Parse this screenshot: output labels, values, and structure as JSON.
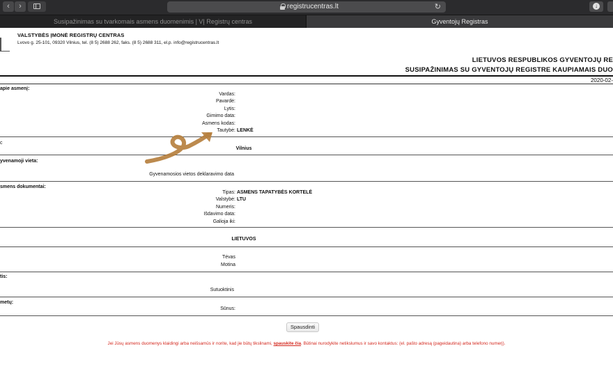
{
  "browser": {
    "url": "registrucentras.lt",
    "back_icon": "‹",
    "forward_icon": "›",
    "reload_icon": "↻",
    "tabs": [
      {
        "label": "Susipažinimas su tvarkomais asmens duomenimis | VĮ Registrų centras",
        "active": false
      },
      {
        "label": "Gyventojų Registras",
        "active": true
      }
    ]
  },
  "header": {
    "org_name": "VALSTYBĖS ĮMONĖ REGISTRŲ CENTRAS",
    "org_address": "Lvovo g. 25-101, 09320 Vilnius, tel. (8 5) 2688 262, faks. (8 5) 2688 311, el.p. info@registrucentras.lt",
    "title": "LIETUVOS RESPUBLIKOS GYVENTOJŲ RE",
    "subtitle": "SUSIPAŽINIMAS SU GYVENTOJŲ REGISTRE KAUPIAMAIS DUO",
    "date": "2020-02-"
  },
  "sections": {
    "person": {
      "title": "apie asmenį:",
      "fields": [
        {
          "label": "Vardas:",
          "value": ""
        },
        {
          "label": "Pavardė:",
          "value": ""
        },
        {
          "label": "Lytis:",
          "value": ""
        },
        {
          "label": "Gimimo data:",
          "value": ""
        },
        {
          "label": "Asmens kodas:",
          "value": ""
        },
        {
          "label": "Tautybė:",
          "value": "LENKĖ"
        }
      ]
    },
    "place": {
      "title": "c",
      "value": "Vilnius"
    },
    "residence": {
      "title": "yvenamoji vieta:",
      "field_label": "Gyvenamosios vietos deklaravimo data"
    },
    "documents": {
      "title": "smens dokumentai:",
      "fields": [
        {
          "label": "Tipas:",
          "value": "ASMENS TAPATYBĖS KORTELĖ"
        },
        {
          "label": "Valstybė:",
          "value": "LTU"
        },
        {
          "label": "Numeris:",
          "value": ""
        },
        {
          "label": "Išdavimo data:",
          "value": ""
        },
        {
          "label": "Galioja iki:",
          "value": ""
        }
      ]
    },
    "citizenship": {
      "value": "LIETUVOS"
    },
    "parents": {
      "fields": [
        {
          "label": "Tėvas",
          "value": ""
        },
        {
          "label": "Motina",
          "value": ""
        }
      ]
    },
    "marriage": {
      "title": "tis:",
      "field_label": "Sutuoktinis"
    },
    "children": {
      "title": "metų:",
      "field_label": "Sūnus:"
    }
  },
  "actions": {
    "print_label": "Spausdinti"
  },
  "notice": {
    "before": "Jei Jūsų asmens duomenys klaidingi arba neišsamūs ir norite, kad jie būtų tikslinami, ",
    "link": "spauskite čia",
    "after": ". Būtinai nurodykite netikslumus ir savo kontaktus: (el. pašto adresą (pageidautina) arba telefono numerį)."
  },
  "annotation": {
    "type": "curly-arrow",
    "color": "#b6803f"
  }
}
